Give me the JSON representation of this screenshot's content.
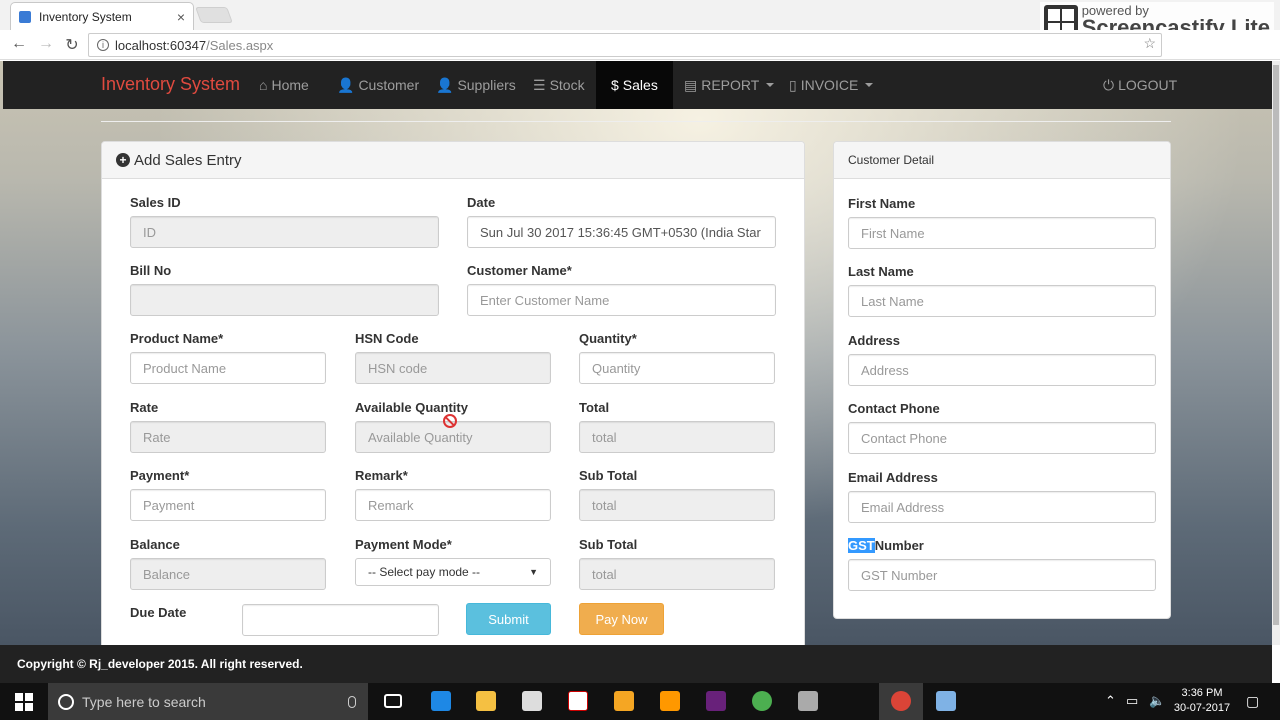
{
  "browser": {
    "tab_title": "Inventory System",
    "tab_close": "×",
    "url_host": "localhost:60347",
    "url_path": "/Sales.aspx",
    "back": "←",
    "forward": "→",
    "reload": "↻",
    "info": "i",
    "star": "☆"
  },
  "watermark": {
    "powered": "powered by",
    "name": "Screencastify Lite"
  },
  "navbar": {
    "brand": "Inventory System",
    "items": [
      {
        "icon": "home-icon",
        "label": "Home"
      },
      {
        "icon": "user-icon",
        "label": "Customer"
      },
      {
        "icon": "user-icon",
        "label": "Suppliers"
      },
      {
        "icon": "list-icon",
        "label": "Stock"
      },
      {
        "icon": "dollar-icon",
        "label": "Sales"
      },
      {
        "icon": "list-alt-icon",
        "label": "REPORT"
      },
      {
        "icon": "file-icon",
        "label": "INVOICE"
      }
    ],
    "logout": "LOGOUT",
    "active": "Sales"
  },
  "sales_panel": {
    "title": "Add Sales Entry",
    "sales_id": {
      "label": "Sales ID",
      "placeholder": "ID"
    },
    "date": {
      "label": "Date",
      "value": "Sun Jul 30 2017 15:36:45 GMT+0530 (India Star"
    },
    "bill_no": {
      "label": "Bill No",
      "placeholder": ""
    },
    "customer_name": {
      "label": "Customer Name*",
      "placeholder": "Enter Customer Name"
    },
    "product_name": {
      "label": "Product Name*",
      "placeholder": "Product Name"
    },
    "hsn_code": {
      "label": "HSN Code",
      "placeholder": "HSN code"
    },
    "quantity": {
      "label": "Quantity*",
      "placeholder": "Quantity"
    },
    "rate": {
      "label": "Rate",
      "placeholder": "Rate"
    },
    "available_quantity": {
      "label": "Available Quantity",
      "placeholder": "Available Quantity"
    },
    "total": {
      "label": "Total",
      "placeholder": "total"
    },
    "payment": {
      "label": "Payment*",
      "placeholder": "Payment"
    },
    "remark": {
      "label": "Remark*",
      "placeholder": "Remark"
    },
    "sub_total_1": {
      "label": "Sub Total",
      "placeholder": "total"
    },
    "balance": {
      "label": "Balance",
      "placeholder": "Balance"
    },
    "payment_mode": {
      "label": "Payment Mode*",
      "selected": "-- Select pay mode --"
    },
    "sub_total_2": {
      "label": "Sub Total",
      "placeholder": "total"
    },
    "due_date": {
      "label": "Due Date",
      "value": ""
    },
    "submit": "Submit",
    "pay_now": "Pay Now"
  },
  "customer_panel": {
    "title": "Customer Detail",
    "first_name": {
      "label": "First Name",
      "placeholder": "First Name"
    },
    "last_name": {
      "label": "Last Name",
      "placeholder": "Last Name"
    },
    "address": {
      "label": "Address",
      "placeholder": "Address"
    },
    "contact_phone": {
      "label": "Contact Phone",
      "placeholder": "Contact Phone"
    },
    "email": {
      "label": "Email Address",
      "placeholder": "Email Address"
    },
    "gst": {
      "label_highlight": "GST",
      "label_rest": "Number",
      "placeholder": "GST Number"
    }
  },
  "footer": {
    "text": "Copyright © Rj_developer 2015. All right reserved."
  },
  "taskbar": {
    "search_placeholder": "Type here to search",
    "time": "3:36 PM",
    "date": "30-07-2017"
  },
  "colors": {
    "brand": "#e04a3f",
    "navbar": "#222222",
    "submit": "#5bc0de",
    "pay_now": "#f0ad4e"
  }
}
